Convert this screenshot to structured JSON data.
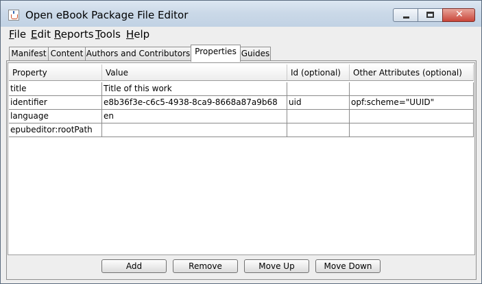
{
  "window": {
    "title": "Open eBook Package File Editor"
  },
  "menubar": {
    "items": [
      {
        "label": "File",
        "mnemonic": "F"
      },
      {
        "label": "Edit",
        "mnemonic": "E"
      },
      {
        "label": "Reports",
        "mnemonic": "R"
      },
      {
        "label": "Tools",
        "mnemonic": "T"
      },
      {
        "label": "Help",
        "mnemonic": "H"
      }
    ]
  },
  "tabs": [
    {
      "label": "Manifest",
      "active": false
    },
    {
      "label": "Content",
      "active": false
    },
    {
      "label": "Authors and Contributors",
      "active": false
    },
    {
      "label": "Properties",
      "active": true
    },
    {
      "label": "Guides",
      "active": false
    }
  ],
  "table": {
    "columns": [
      "Property",
      "Value",
      "Id (optional)",
      "Other Attributes (optional)"
    ],
    "rows": [
      [
        "title",
        "Title of this work",
        "",
        ""
      ],
      [
        "identifier",
        "e8b36f3e-c6c5-4938-8ca9-8668a87a9b68",
        "uid",
        "opf:scheme=\"UUID\""
      ],
      [
        "language",
        "en",
        "",
        ""
      ],
      [
        "epubeditor:rootPath",
        "",
        "",
        ""
      ]
    ]
  },
  "buttons": {
    "add": "Add",
    "remove": "Remove",
    "move_up": "Move Up",
    "move_down": "Move Down"
  }
}
